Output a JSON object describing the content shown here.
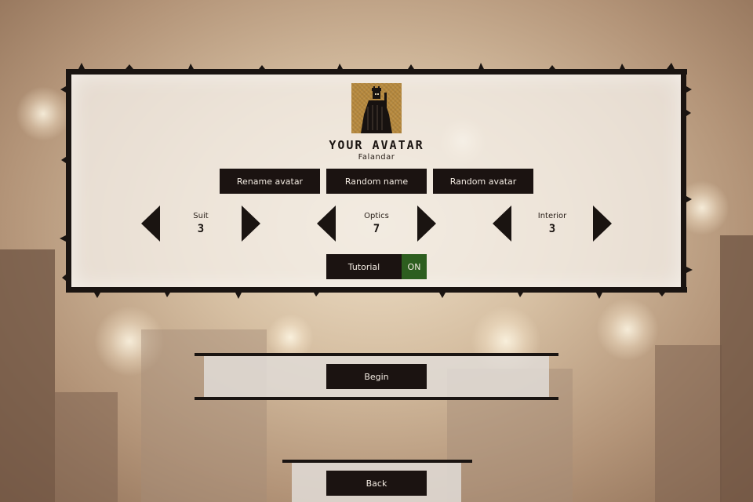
{
  "avatar": {
    "title": "YOUR AVATAR",
    "name": "Falandar",
    "icon": "cloaked-figure-icon",
    "background_color": "#b88a3e"
  },
  "actions": {
    "rename_label": "Rename avatar",
    "random_name_label": "Random name",
    "random_avatar_label": "Random avatar"
  },
  "selectors": [
    {
      "label": "Suit",
      "value": "3"
    },
    {
      "label": "Optics",
      "value": "7"
    },
    {
      "label": "Interior",
      "value": "3"
    }
  ],
  "tutorial": {
    "label": "Tutorial",
    "state": "ON",
    "state_color": "#2d5e1f"
  },
  "begin_label": "Begin",
  "back_label": "Back",
  "colors": {
    "button_bg": "#1b1311",
    "button_text": "#f3ebe2",
    "frame": "#1a1411"
  }
}
